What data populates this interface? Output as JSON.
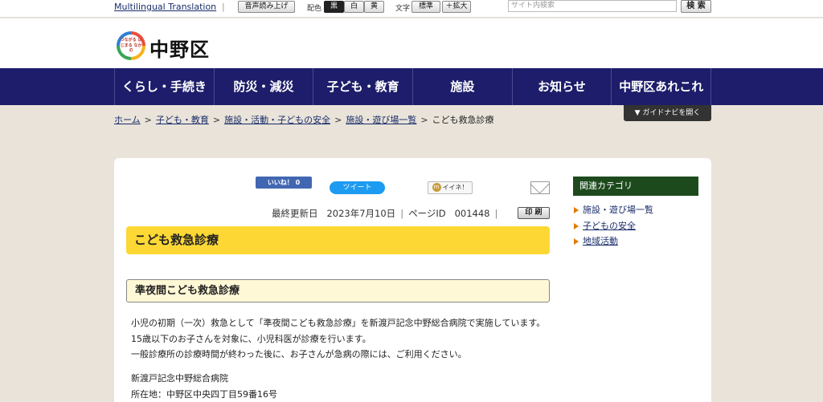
{
  "topbar": {
    "multilingual": "Multilingual Translation",
    "read_aloud": "音声読み上げ",
    "color_label": "配色",
    "color_options": [
      "黒",
      "白",
      "黄"
    ],
    "text_label": "文字",
    "text_standard": "標準",
    "text_enlarge": "＋拡大",
    "search_placeholder": "サイト内検索",
    "search_button": "検 索"
  },
  "header": {
    "logo_mark_text": "つながる はじまる なかの",
    "site_name": "中野区"
  },
  "nav": {
    "items": [
      "くらし・手続き",
      "防災・減災",
      "子ども・教育",
      "施設",
      "お知らせ",
      "中野区あれこれ"
    ]
  },
  "breadcrumb": {
    "items": [
      "ホーム",
      "子ども・教育",
      "施設・活動・子どもの安全",
      "施設・遊び場一覧"
    ],
    "current": "こども救急診療",
    "arrow": ">"
  },
  "guide_button": "▼ ガイドナビを開く",
  "social": {
    "facebook": "いいね！ 0",
    "twitter": "ツイート",
    "mixi": "イイネ！",
    "mixi_mark": "m"
  },
  "meta": {
    "updated_label": "最終更新日",
    "updated_date": "2023年7月10日",
    "page_id_label": "ページID",
    "page_id": "001448",
    "print": "印 刷"
  },
  "main": {
    "title": "こども救急診療",
    "section_title": "準夜間こども救急診療",
    "paragraphs": [
      "小児の初期（一次）救急として「準夜間こども救急診療」を新渡戸記念中野総合病院で実施しています。",
      "15歳以下のお子さんを対象に、小児科医が診療を行います。",
      "一般診療所の診療時間が終わった後に、お子さんが急病の際には、ご利用ください。"
    ],
    "hospital_name": "新渡戸記念中野総合病院",
    "address": "所在地：中野区中央四丁目59番16号"
  },
  "sidebar": {
    "heading": "関連カテゴリ",
    "items": [
      "施設・遊び場一覧",
      "子どもの安全",
      "地域活動"
    ]
  }
}
